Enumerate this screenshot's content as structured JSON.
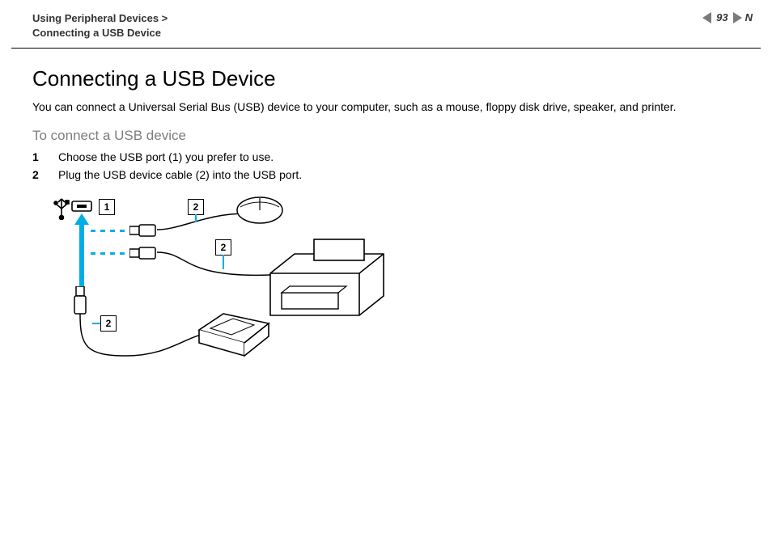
{
  "breadcrumb": {
    "line1": "Using Peripheral Devices >",
    "line2": "Connecting a USB Device"
  },
  "page_number": "93",
  "N": "N",
  "title": "Connecting a USB Device",
  "intro": "You can connect a Universal Serial Bus (USB) device to your computer, such as a mouse, floppy disk drive, speaker, and printer.",
  "subhead": "To connect a USB device",
  "steps": [
    {
      "n": "1",
      "text": "Choose the USB port (1) you prefer to use."
    },
    {
      "n": "2",
      "text": "Plug the USB device cable (2) into the USB port."
    }
  ],
  "callouts": {
    "c1": "1",
    "c2a": "2",
    "c2b": "2",
    "c2c": "2"
  }
}
